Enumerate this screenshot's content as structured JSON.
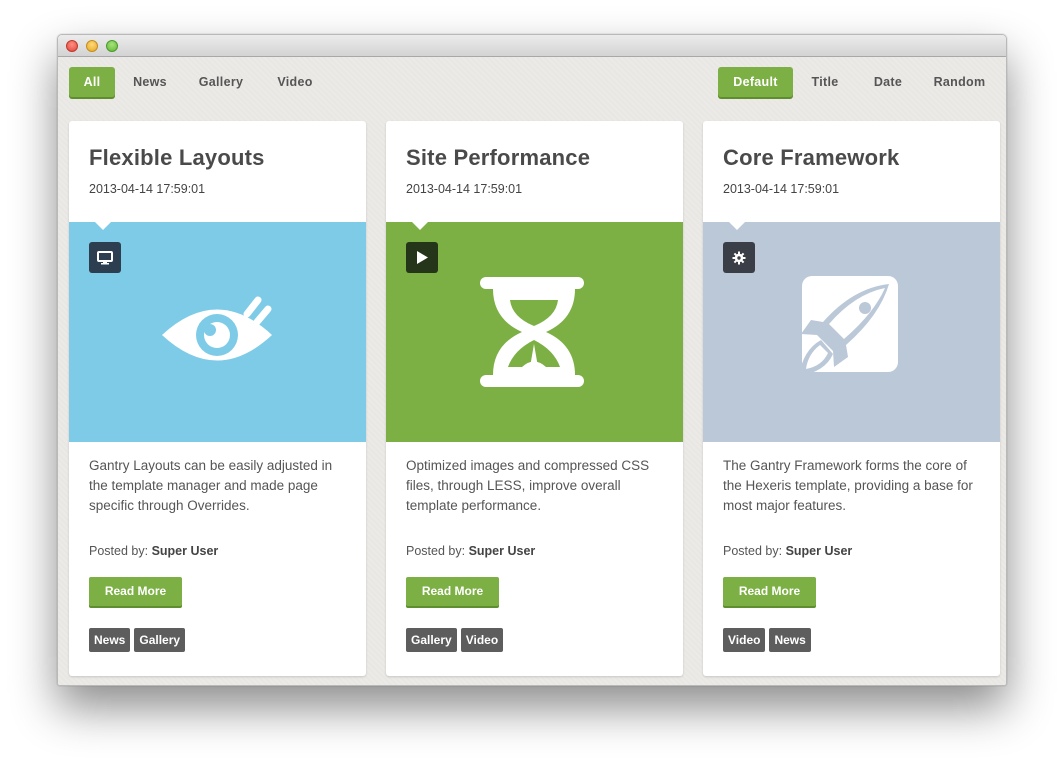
{
  "filters": {
    "category": [
      {
        "label": "All",
        "active": true
      },
      {
        "label": "News",
        "active": false
      },
      {
        "label": "Gallery",
        "active": false
      },
      {
        "label": "Video",
        "active": false
      }
    ],
    "sort": [
      {
        "label": "Default",
        "active": true
      },
      {
        "label": "Title",
        "active": false
      },
      {
        "label": "Date",
        "active": false
      },
      {
        "label": "Random",
        "active": false
      }
    ]
  },
  "posted_by_label": "Posted by:",
  "read_more_label": "Read More",
  "cards": [
    {
      "title": "Flexible Layouts",
      "date": "2013-04-14 17:59:01",
      "media_color": "#7ecbe8",
      "badge_color": "#2c3e50",
      "badge_icon": "monitor-icon",
      "hero_icon": "eye-icon",
      "description": "Gantry Layouts can be easily adjusted in the template manager and made page specific through Overrides.",
      "author": "Super User",
      "tags": [
        "News",
        "Gallery"
      ]
    },
    {
      "title": "Site Performance",
      "date": "2013-04-14 17:59:01",
      "media_color": "#7cb044",
      "badge_color": "#24351a",
      "badge_icon": "play-icon",
      "hero_icon": "hourglass-icon",
      "description": "Optimized images and compressed CSS files, through LESS, improve overall template performance.",
      "author": "Super User",
      "tags": [
        "Gallery",
        "Video"
      ]
    },
    {
      "title": "Core Framework",
      "date": "2013-04-14 17:59:01",
      "media_color": "#bbc8d8",
      "badge_color": "#3a3f47",
      "badge_icon": "gear-icon",
      "hero_icon": "rocket-icon",
      "description": "The Gantry Framework forms the core of the Hexeris template, providing a base for most major features.",
      "author": "Super User",
      "tags": [
        "Video",
        "News"
      ]
    }
  ]
}
